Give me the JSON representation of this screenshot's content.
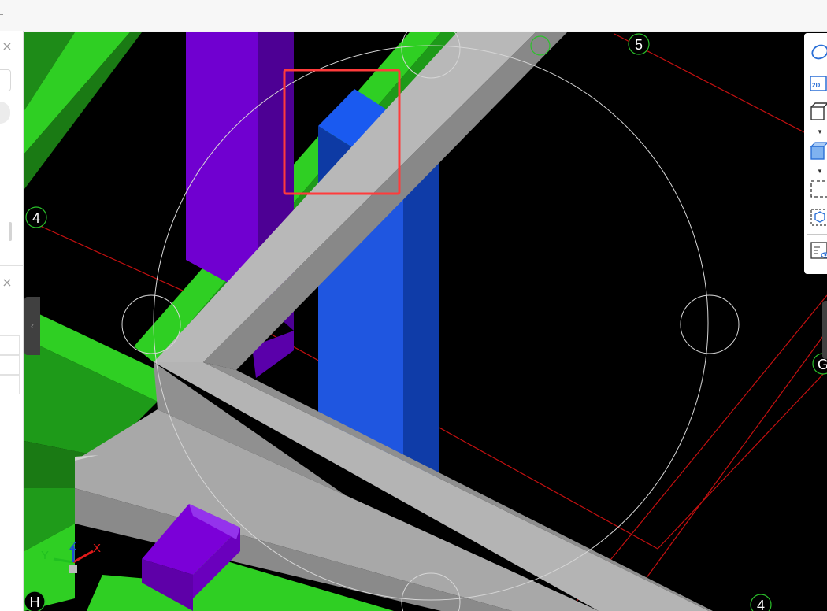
{
  "window": {
    "close_symbol": "×",
    "collapse_symbol": "‹"
  },
  "viewport": {
    "grid_labels": {
      "grid_4_left": "4",
      "grid_5_top": "5",
      "grid_g_right": "G",
      "grid_h_bottom": "H",
      "grid_4_bottom": "4"
    },
    "axis_triad": {
      "x_label": "X",
      "y_label": "Y",
      "z_label": "Z"
    },
    "colors": {
      "background": "#000000",
      "green_beam": "#2ecc20",
      "purple_column": "#7a00d6",
      "blue_column": "#1f56e0",
      "grey_beam": "#b8b8b8",
      "grid_line": "#c41010",
      "selection_box": "#ff3333"
    }
  },
  "view_toolbar": {
    "icons": [
      "orbit-icon",
      "view-2d-icon",
      "view-cube-icon",
      "shaded-cube-icon",
      "section-box-icon",
      "isolate-3d-icon",
      "visibility-list-icon"
    ],
    "label_2d": "2D"
  }
}
